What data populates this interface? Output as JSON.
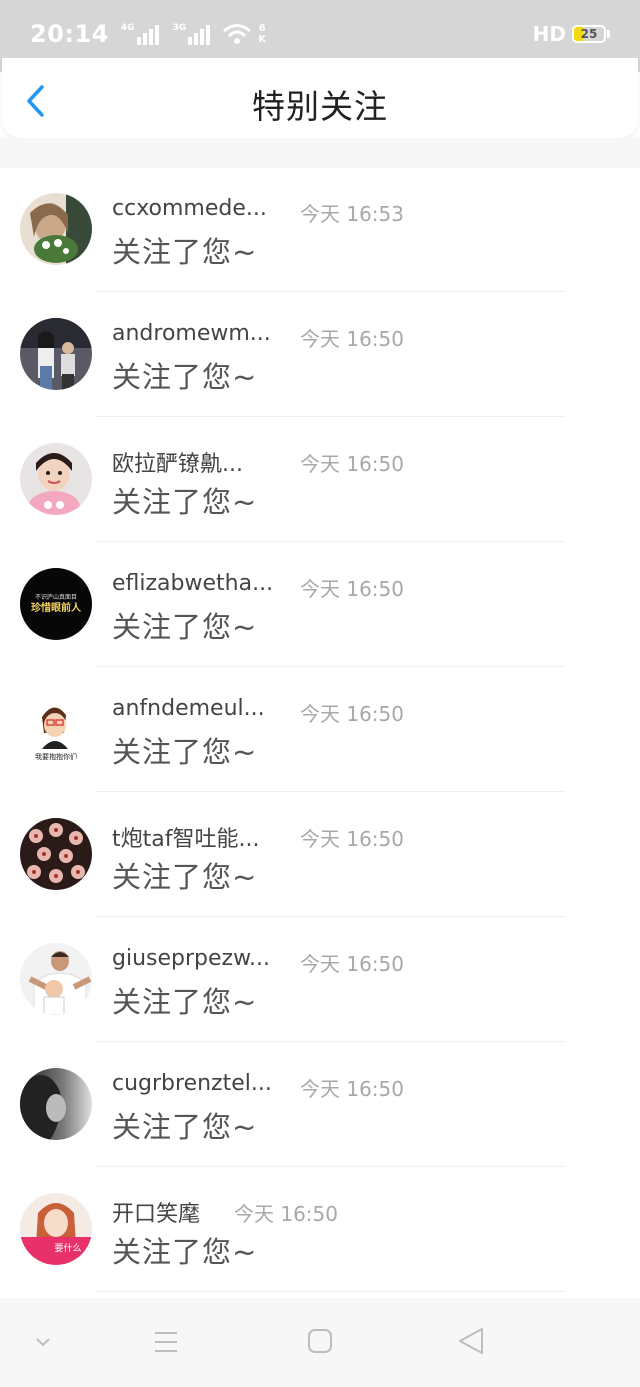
{
  "status_bar": {
    "time": "20:14",
    "sim1_gen": "4G",
    "sim2_gen": "3G",
    "net_speed_top": "6",
    "net_speed_bottom": "K",
    "hd": "HD",
    "battery": "25",
    "battery_color": "#f5d90a"
  },
  "header": {
    "back_icon": "chevron-left-icon",
    "title": "特别关注",
    "accent": "#2196f3"
  },
  "list": [
    {
      "name": "ccxommede...",
      "time": "今天 16:53",
      "message": "关注了您~"
    },
    {
      "name": "andromewm...",
      "time": "今天 16:50",
      "message": "关注了您~"
    },
    {
      "name": "欧拉酽镣鼽...",
      "time": "今天 16:50",
      "message": "关注了您~"
    },
    {
      "name": "eflizabwetha...",
      "time": "今天 16:50",
      "message": "关注了您~"
    },
    {
      "name": "anfndemeul...",
      "time": "今天 16:50",
      "message": "关注了您~"
    },
    {
      "name": "t炮taf智吐能...",
      "time": "今天 16:50",
      "message": "关注了您~"
    },
    {
      "name": "giuseprpezw...",
      "time": "今天 16:50",
      "message": "关注了您~"
    },
    {
      "name": "cugrbrenztel...",
      "time": "今天 16:50",
      "message": "关注了您~"
    },
    {
      "name": "开口笑麾",
      "time": "今天 16:50",
      "message": "关注了您~"
    }
  ],
  "avatar_texts": {
    "avatar4_line1": "不识庐山真面目",
    "avatar4_line2": "珍惜眼前人",
    "avatar5_caption": "我要抱抱你们",
    "avatar9_caption": "要什么"
  },
  "nav_bar": {
    "icons": [
      "chevron-down-icon",
      "menu-icon",
      "home-square-icon",
      "back-triangle-icon"
    ]
  }
}
